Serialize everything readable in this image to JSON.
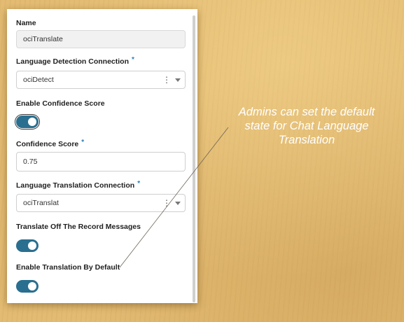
{
  "form": {
    "name": {
      "label": "Name",
      "value": "ociTranslate"
    },
    "detection_connection": {
      "label": "Language Detection Connection",
      "required": "*",
      "value": "ociDetect"
    },
    "enable_confidence": {
      "label": "Enable Confidence Score",
      "on": true
    },
    "confidence_score": {
      "label": "Confidence Score",
      "required": "*",
      "value": "0.75"
    },
    "translation_connection": {
      "label": "Language Translation Connection",
      "required": "*",
      "value": "ociTranslat"
    },
    "translate_off_record": {
      "label": "Translate Off The Record Messages",
      "on": true
    },
    "translation_default": {
      "label": "Enable Translation By Default",
      "on": true
    }
  },
  "callout": {
    "lines": [
      "Admins can set the default",
      "state for Chat Language",
      "Translation"
    ],
    "color": "#ffffff"
  },
  "colors": {
    "toggle_on": "#2a6f8f",
    "required_marker": "#2c7fb8",
    "background": "#e3bb72"
  },
  "icons": {
    "select_menu": "kebab-icon",
    "select_dropdown": "chevron-down-icon"
  }
}
